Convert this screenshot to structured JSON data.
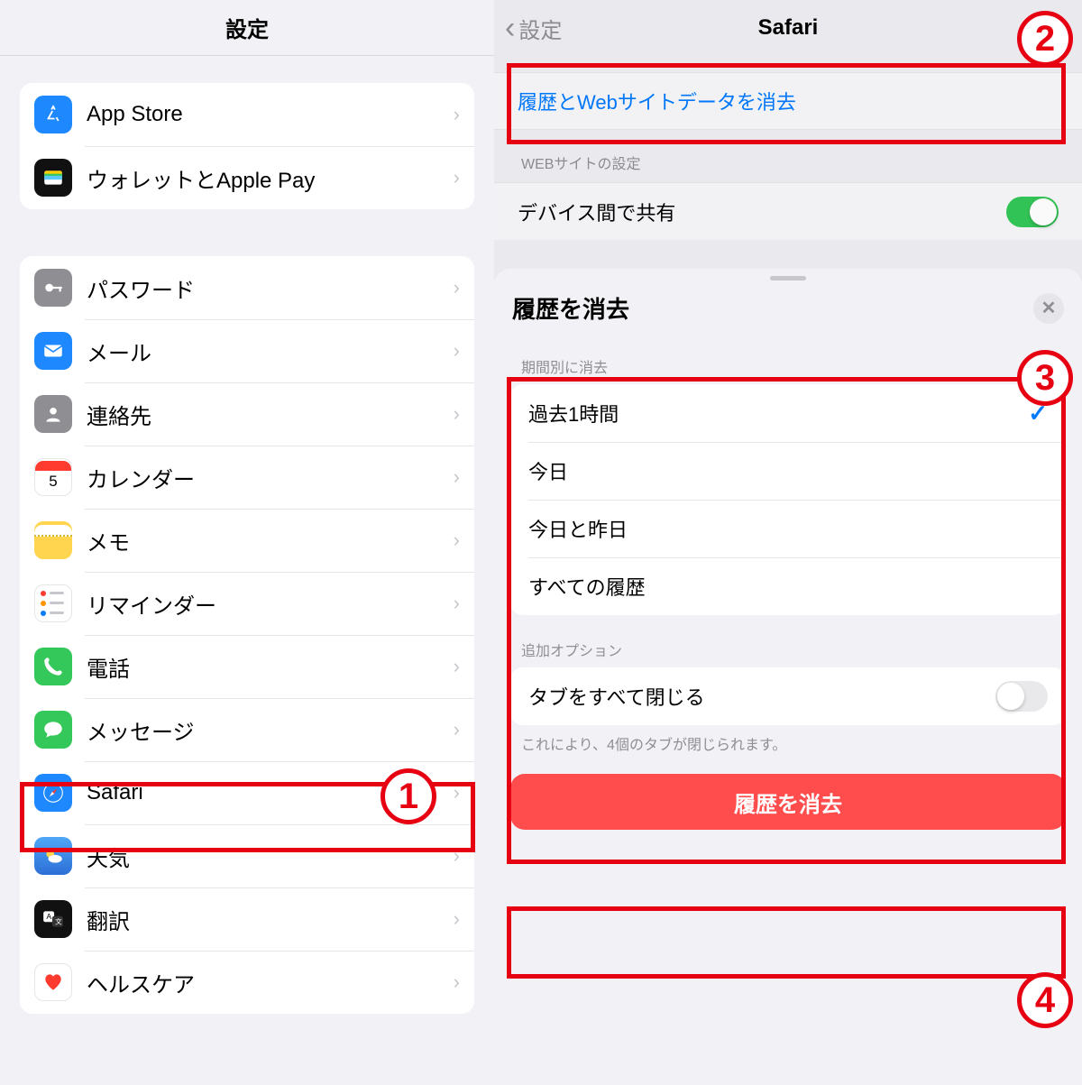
{
  "left": {
    "title": "設定",
    "group1": [
      {
        "name": "appstore",
        "label": "App Store"
      },
      {
        "name": "wallet",
        "label": "ウォレットとApple Pay"
      }
    ],
    "group2": [
      {
        "name": "password",
        "label": "パスワード"
      },
      {
        "name": "mail",
        "label": "メール"
      },
      {
        "name": "contacts",
        "label": "連絡先"
      },
      {
        "name": "calendar",
        "label": "カレンダー"
      },
      {
        "name": "notes",
        "label": "メモ"
      },
      {
        "name": "reminders",
        "label": "リマインダー"
      },
      {
        "name": "phone",
        "label": "電話"
      },
      {
        "name": "messages",
        "label": "メッセージ"
      },
      {
        "name": "safari",
        "label": "Safari"
      },
      {
        "name": "weather",
        "label": "天気"
      },
      {
        "name": "translate",
        "label": "翻訳"
      },
      {
        "name": "health",
        "label": "ヘルスケア"
      }
    ]
  },
  "right": {
    "back_label": "設定",
    "title": "Safari",
    "clear_link": "履歴とWebサイトデータを消去",
    "website_settings_header": "WEBサイトの設定",
    "share_across_devices": "デバイス間で共有",
    "sheet": {
      "title": "履歴を消去",
      "period_header": "期間別に消去",
      "periods": [
        {
          "label": "過去1時間",
          "selected": true
        },
        {
          "label": "今日",
          "selected": false
        },
        {
          "label": "今日と昨日",
          "selected": false
        },
        {
          "label": "すべての履歴",
          "selected": false
        }
      ],
      "options_header": "追加オプション",
      "close_all_tabs_label": "タブをすべて閉じる",
      "close_all_tabs_on": false,
      "footer_text": "これにより、4個のタブが閉じられます。",
      "confirm_button": "履歴を消去"
    }
  },
  "callouts": {
    "n1": "1",
    "n2": "2",
    "n3": "3",
    "n4": "4"
  }
}
